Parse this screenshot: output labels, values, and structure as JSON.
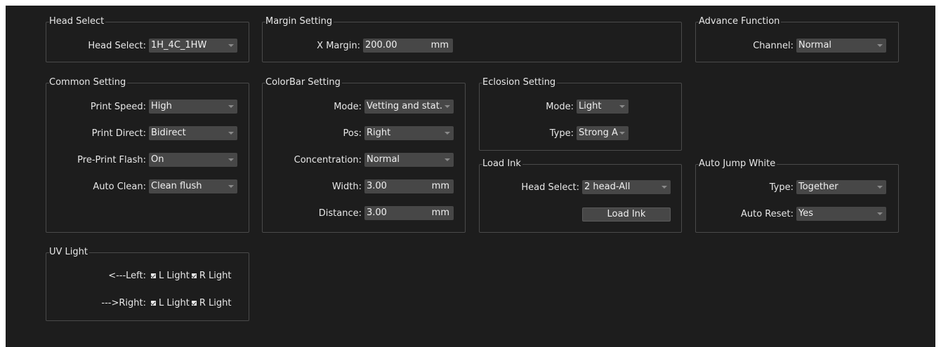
{
  "head_select_group": {
    "title": "Head Select",
    "label": "Head Select:",
    "value": "1H_4C_1HW"
  },
  "margin_group": {
    "title": "Margin Setting",
    "x_margin_label": "X Margin:",
    "x_margin_value": "200.00",
    "unit": "mm"
  },
  "advance_group": {
    "title": "Advance Function",
    "channel_label": "Channel:",
    "channel_value": "Normal"
  },
  "common_group": {
    "title": "Common Setting",
    "print_speed_label": "Print Speed:",
    "print_speed_value": "High",
    "print_direct_label": "Print Direct:",
    "print_direct_value": "Bidirect",
    "preprint_flash_label": "Pre-Print Flash:",
    "preprint_flash_value": "On",
    "auto_clean_label": "Auto Clean:",
    "auto_clean_value": "Clean flush"
  },
  "colorbar_group": {
    "title": "ColorBar Setting",
    "mode_label": "Mode:",
    "mode_value": "Vetting and stat.",
    "pos_label": "Pos:",
    "pos_value": "Right",
    "concentration_label": "Concentration:",
    "concentration_value": "Normal",
    "width_label": "Width:",
    "width_value": "3.00",
    "distance_label": "Distance:",
    "distance_value": "3.00",
    "unit": "mm"
  },
  "eclosion_group": {
    "title": "Eclosion Setting",
    "mode_label": "Mode:",
    "mode_value": "Light",
    "type_label": "Type:",
    "type_value": "Strong A"
  },
  "load_ink_group": {
    "title": "Load Ink",
    "head_select_label": "Head Select:",
    "head_select_value": "2 head-All",
    "button_label": "Load Ink"
  },
  "auto_jump_group": {
    "title": "Auto Jump White",
    "type_label": "Type:",
    "type_value": "Together",
    "auto_reset_label": "Auto Reset:",
    "auto_reset_value": "Yes"
  },
  "uv_group": {
    "title": "UV Light",
    "left_label": "<---Left:",
    "right_label": "--->Right:",
    "l_light_label": "L Light",
    "r_light_label": "R Light",
    "left_l_checked": true,
    "left_r_checked": true,
    "right_l_checked": true,
    "right_r_checked": true
  }
}
